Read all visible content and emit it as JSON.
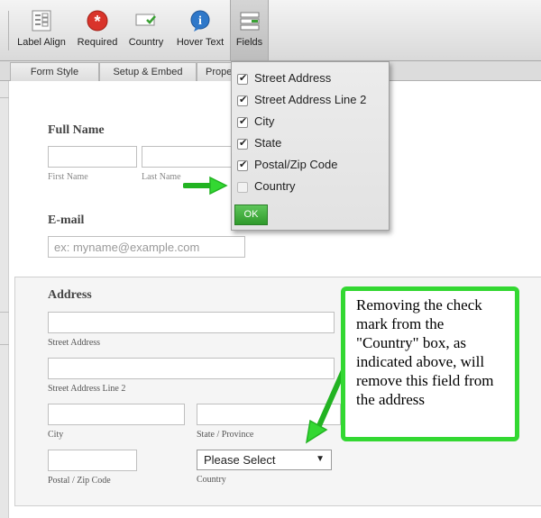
{
  "toolbar": {
    "buttons": [
      {
        "label": "Label Align",
        "icon": "label-align-icon"
      },
      {
        "label": "Required",
        "icon": "required-icon"
      },
      {
        "label": "Country",
        "icon": "country-icon"
      },
      {
        "label": "Hover Text",
        "icon": "info-icon"
      },
      {
        "label": "Fields",
        "icon": "fields-icon"
      }
    ]
  },
  "tabs": [
    {
      "label": "Form Style"
    },
    {
      "label": "Setup & Embed"
    },
    {
      "label": "Prope"
    }
  ],
  "form": {
    "full_name": {
      "label": "Full Name",
      "first_label": "First Name",
      "last_label": "Last Name"
    },
    "email": {
      "label": "E-mail",
      "placeholder": "ex: myname@example.com"
    },
    "address": {
      "label": "Address",
      "street_label": "Street Address",
      "street2_label": "Street Address Line 2",
      "city_label": "City",
      "state_label": "State / Province",
      "zip_label": "Postal / Zip Code",
      "country_label": "Country",
      "country_value": "Please Select"
    }
  },
  "fields_popup": {
    "options": [
      {
        "label": "Street Address",
        "checked": true
      },
      {
        "label": "Street Address Line 2",
        "checked": true
      },
      {
        "label": "City",
        "checked": true
      },
      {
        "label": "State",
        "checked": true
      },
      {
        "label": "Postal/Zip Code",
        "checked": true
      },
      {
        "label": "Country",
        "checked": false
      }
    ],
    "ok_label": "OK"
  },
  "callout": {
    "text": "Removing the check mark from the \"Country\" box, as indicated above, will remove this field from the address"
  },
  "colors": {
    "accent_green": "#33d832",
    "required_red": "#d9342b",
    "info_blue": "#2f78c9"
  }
}
